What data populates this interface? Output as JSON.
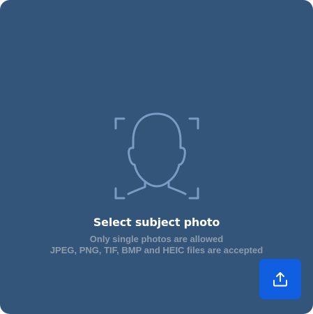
{
  "dropzone": {
    "title": "Select subject photo",
    "line1": "Only single photos are allowed",
    "line2": "JPEG, PNG, TIF, BMP and HEIC files are accepted",
    "icon": "face-scan-icon"
  },
  "upload_button": {
    "icon": "upload-icon"
  },
  "colors": {
    "panel": "#34557a",
    "icon_stroke": "#7a9bc4",
    "title": "#ffffff",
    "subtitle": "#8e9bab",
    "button": "#0f5fe0"
  }
}
